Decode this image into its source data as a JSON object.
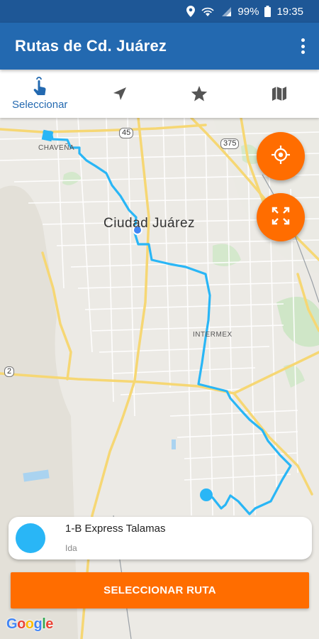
{
  "status_bar": {
    "battery": "99%",
    "time": "19:35",
    "icons": [
      "location-icon",
      "wifi-icon",
      "signal-icon",
      "battery-icon"
    ]
  },
  "app_bar": {
    "title": "Rutas de Cd. Juárez",
    "menu_icon": "overflow-menu-icon"
  },
  "tabs": [
    {
      "id": "select",
      "label": "Seleccionar",
      "icon": "tap-hand-icon",
      "active": true
    },
    {
      "id": "navigate",
      "label": "",
      "icon": "navigation-arrow-icon",
      "active": false
    },
    {
      "id": "favorites",
      "label": "",
      "icon": "star-icon",
      "active": false
    },
    {
      "id": "map",
      "label": "",
      "icon": "map-icon",
      "active": false
    }
  ],
  "map": {
    "labels": {
      "city": "Ciudad Juárez",
      "chavena": "CHAVEÑA",
      "intermex": "INTERMEX"
    },
    "shields": [
      "45",
      "375",
      "2"
    ],
    "fabs": [
      {
        "id": "my-location",
        "icon": "crosshair-icon"
      },
      {
        "id": "fit-route",
        "icon": "expand-icon"
      }
    ]
  },
  "route_card": {
    "name": "1-B Express Talamas",
    "direction": "Ida"
  },
  "select_button": {
    "label": "SELECCIONAR RUTA"
  },
  "attribution": {
    "letters": [
      "G",
      "o",
      "o",
      "g",
      "l",
      "e"
    ]
  },
  "colors": {
    "status_bar": "#1e5796",
    "app_bar": "#2369b0",
    "accent": "#ff6d00",
    "route": "#29b6f6"
  }
}
